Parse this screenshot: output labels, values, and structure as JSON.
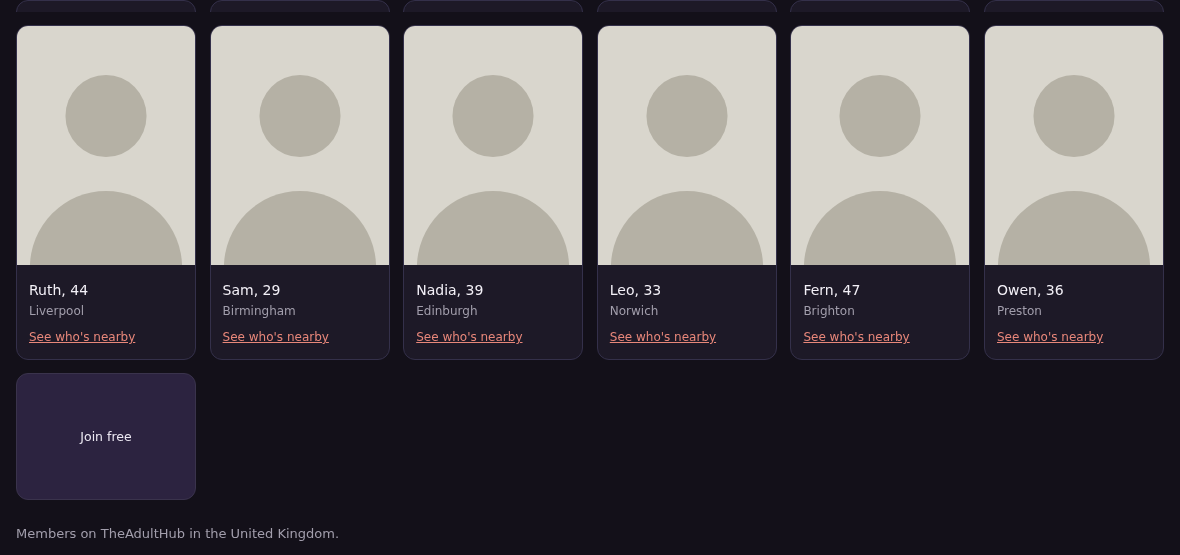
{
  "cut_off_cards": [
    {
      "kind": "card"
    },
    {
      "kind": "card"
    },
    {
      "kind": "card"
    },
    {
      "kind": "card"
    },
    {
      "kind": "card"
    },
    {
      "kind": "card"
    }
  ],
  "members": [
    {
      "name": "Ruth, 44",
      "city": "Liverpool",
      "link": "See who's nearby"
    },
    {
      "name": "Sam, 29",
      "city": "Birmingham",
      "link": "See who's nearby"
    },
    {
      "name": "Nadia, 39",
      "city": "Edinburgh",
      "link": "See who's nearby"
    },
    {
      "name": "Leo, 33",
      "city": "Norwich",
      "link": "See who's nearby"
    },
    {
      "name": "Fern, 47",
      "city": "Brighton",
      "link": "See who's nearby"
    },
    {
      "name": "Owen, 36",
      "city": "Preston",
      "link": "See who's nearby"
    }
  ],
  "join_card": {
    "label": "Join free"
  },
  "footer": "Members on TheAdultHub in the United Kingdom."
}
